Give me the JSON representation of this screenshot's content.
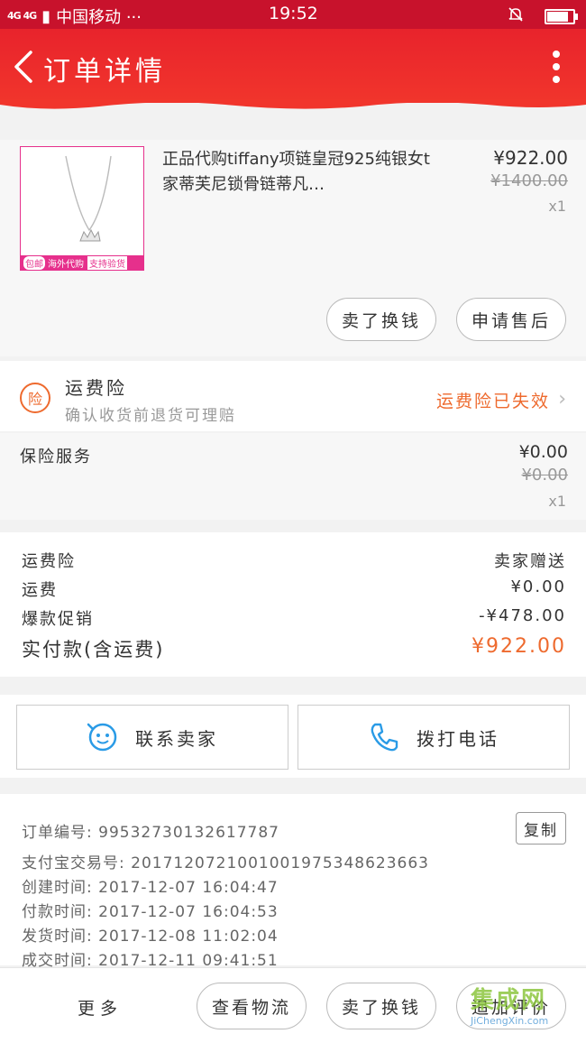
{
  "status_bar": {
    "network": "4G 4G",
    "carrier": "中国移动 ···",
    "time": "19:52",
    "battery_level": 0.9
  },
  "nav": {
    "title": "订单详情"
  },
  "product": {
    "name": "正品代购tiffany项链皇冠925纯银女t家蒂芙尼锁骨链蒂凡…",
    "price": "¥922.00",
    "original_price": "¥1400.00",
    "quantity": "x1",
    "thumb_tags": [
      "包邮",
      "海外代购",
      "支持验货"
    ],
    "actions": [
      "卖了换钱",
      "申请售后"
    ]
  },
  "insurance": {
    "badge": "险",
    "title": "运费险",
    "subtitle": "确认收货前退货可理赔",
    "status": "运费险已失效"
  },
  "service": {
    "name": "保险服务",
    "price": "¥0.00",
    "original_price": "¥0.00",
    "quantity": "x1"
  },
  "summary": {
    "rows": [
      {
        "label": "运费险",
        "value": "卖家赠送"
      },
      {
        "label": "运费",
        "value": "¥0.00"
      },
      {
        "label": "爆款促销",
        "value": "-¥478.00"
      }
    ],
    "total_label": "实付款(含运费)",
    "total_value": "¥922.00"
  },
  "contact": {
    "seller_label": "联系卖家",
    "phone_label": "拨打电话"
  },
  "order_info": {
    "copy_label": "复制",
    "lines": [
      "订单编号: 99532730132617787",
      "支付宝交易号: 2017120721001001975348623663",
      "创建时间: 2017-12-07 16:04:47",
      "付款时间: 2017-12-07 16:04:53",
      "发货时间: 2017-12-08 11:02:04",
      "成交时间: 2017-12-11 09:41:51"
    ]
  },
  "bottom_bar": {
    "more": "更多",
    "buttons": [
      "查看物流",
      "卖了换钱",
      "追加评价"
    ]
  },
  "watermark": {
    "logo": "集成网",
    "site": "JiChengXin.com"
  },
  "colors": {
    "header_red": "#e8232c",
    "accent_orange": "#ee6a2e",
    "thumb_pink": "#e6308c"
  }
}
